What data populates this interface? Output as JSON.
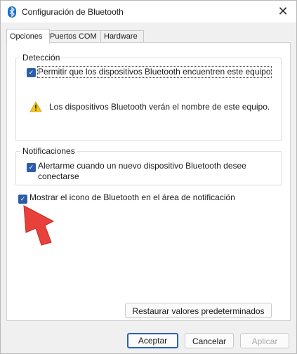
{
  "window": {
    "title": "Configuración de Bluetooth",
    "close_glyph": "✕",
    "icon": "bluetooth-icon"
  },
  "tabs": [
    {
      "label": "Opciones",
      "active": true
    },
    {
      "label": "Puertos COM",
      "active": false
    },
    {
      "label": "Hardware",
      "active": false
    }
  ],
  "detection": {
    "legend": "Detección",
    "allow_discovery": {
      "label": "Permitir que los dispositivos Bluetooth encuentren este equipo",
      "checked": true
    },
    "warning_icon": "warning-icon",
    "warning_text": "Los dispositivos Bluetooth verán el nombre de este equipo."
  },
  "notifications": {
    "legend": "Notificaciones",
    "alert_new_device": {
      "label_line1": "Alertarme cuando un nuevo dispositivo Bluetooth desee",
      "label_line2": "conectarse",
      "checked": true
    }
  },
  "show_tray_icon": {
    "label": "Mostrar el icono de Bluetooth en el área de notificación",
    "checked": true
  },
  "annotation": {
    "icon": "red-arrow-icon"
  },
  "buttons": {
    "restore_defaults": "Restaurar valores predeterminados",
    "accept": "Aceptar",
    "cancel": "Cancelar",
    "apply": "Aplicar"
  },
  "colors": {
    "checkbox": "#2a5fa8",
    "primary_border": "#2a62b8",
    "arrow": "#e8413b",
    "warning": "#f2c511"
  }
}
